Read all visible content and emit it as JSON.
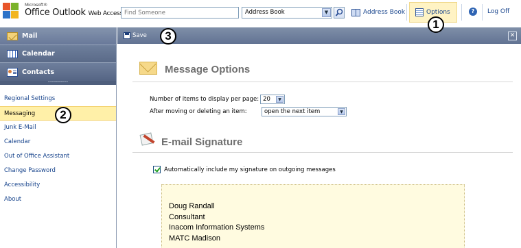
{
  "header": {
    "brand_small": "Microsoft®",
    "brand_main": "Office Outlook",
    "brand_sub": "Web Access",
    "find_placeholder": "Find Someone",
    "address_book_select": "Address Book",
    "address_book_link": "Address Book",
    "options_label": "Options",
    "logoff_label": "Log Off"
  },
  "nav": {
    "main": [
      {
        "label": "Mail",
        "icon": "mail-icon"
      },
      {
        "label": "Calendar",
        "icon": "calendar-icon"
      },
      {
        "label": "Contacts",
        "icon": "contacts-icon"
      }
    ],
    "options": [
      {
        "label": "Regional Settings",
        "active": false
      },
      {
        "label": "Messaging",
        "active": true
      },
      {
        "label": "Junk E-Mail",
        "active": false
      },
      {
        "label": "Calendar",
        "active": false
      },
      {
        "label": "Out of Office Assistant",
        "active": false
      },
      {
        "label": "Change Password",
        "active": false
      },
      {
        "label": "Accessibility",
        "active": false
      },
      {
        "label": "About",
        "active": false
      }
    ]
  },
  "toolbar": {
    "save_label": "Save",
    "close_glyph": "✕"
  },
  "message_options": {
    "title": "Message Options",
    "items_per_page_label": "Number of items to display per page:",
    "items_per_page_value": "20",
    "after_move_label": "After moving or deleting an item:",
    "after_move_value": "open the next item"
  },
  "signature": {
    "title": "E-mail Signature",
    "auto_include_label": "Automatically include my signature on outgoing messages",
    "auto_include_checked": true,
    "lines": [
      "Doug Randall",
      "Consultant",
      "Inacom Information Systems",
      "MATC Madison"
    ]
  },
  "callouts": [
    "1",
    "2",
    "3"
  ],
  "colors": {
    "nav_header": "#6b7b98",
    "highlight": "#fff0a8",
    "link": "#15428b",
    "signature_bg": "#fffbe0"
  }
}
